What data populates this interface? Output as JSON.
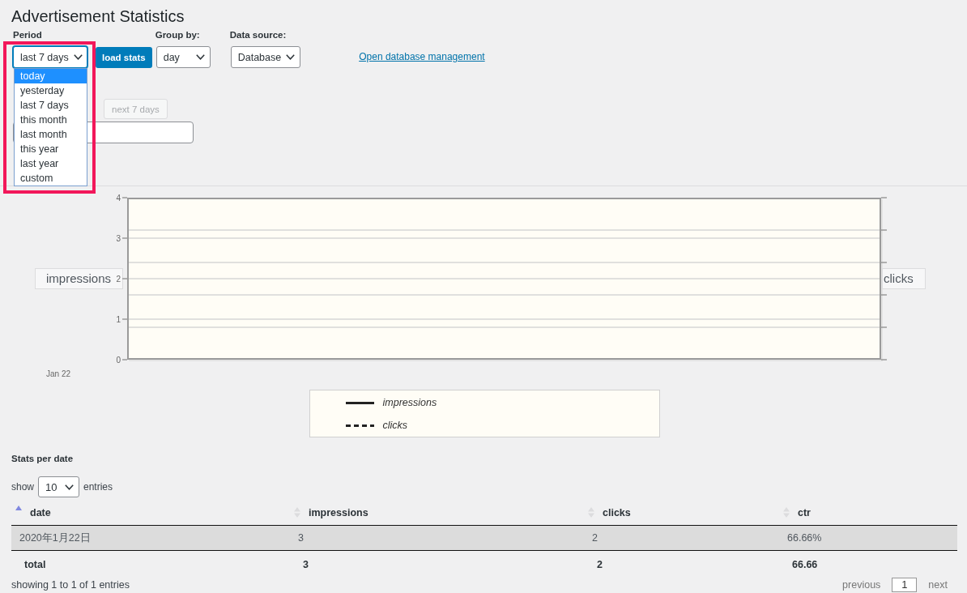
{
  "page": {
    "title": "Advertisement Statistics"
  },
  "filters": {
    "period": {
      "label": "Period",
      "value": "last 7 days",
      "focused": true,
      "open": true,
      "framed": true,
      "options": [
        {
          "label": "today",
          "highlighted": true
        },
        {
          "label": "yesterday",
          "highlighted": false
        },
        {
          "label": "last 7 days",
          "highlighted": false
        },
        {
          "label": "this month",
          "highlighted": false
        },
        {
          "label": "last month",
          "highlighted": false
        },
        {
          "label": "this year",
          "highlighted": false
        },
        {
          "label": "last year",
          "highlighted": false
        },
        {
          "label": "custom",
          "highlighted": false
        }
      ]
    },
    "load_button": {
      "label": "load stats"
    },
    "group_by": {
      "label": "Group by:",
      "value": "day"
    },
    "data_source": {
      "label": "Data source:",
      "value": "Database"
    },
    "database_link": {
      "label": "Open database management"
    },
    "next_button": {
      "label": "next 7 days",
      "disabled": true
    }
  },
  "chart": {
    "y_axis_title": "impressions",
    "y_ticks": [
      "4",
      "3",
      "2",
      "1",
      "0"
    ],
    "y2_axis_title": "clicks",
    "x_ticks": [
      "Jan 22"
    ],
    "legend": [
      {
        "label": "impressions",
        "kind": "solid"
      },
      {
        "label": "clicks",
        "kind": "dashed"
      }
    ]
  },
  "stats_table": {
    "title": "Stats per date",
    "length_menu": {
      "prefix": "show",
      "value": "10",
      "suffix": "entries"
    },
    "columns": [
      {
        "label": "date",
        "sorted": true
      },
      {
        "label": "impressions",
        "sorted": false
      },
      {
        "label": "clicks",
        "sorted": false
      },
      {
        "label": "ctr",
        "sorted": false
      }
    ],
    "rows": [
      {
        "cells": [
          "2020年1月22日",
          "3",
          "2",
          "66.66%"
        ]
      }
    ],
    "totals": [
      "total",
      "3",
      "2",
      "66.66"
    ],
    "info": "showing 1 to 1 of 1 entries",
    "pagination": {
      "previous": "previous",
      "pages": [
        {
          "label": "1",
          "selected": true
        }
      ],
      "next": "next"
    }
  }
}
